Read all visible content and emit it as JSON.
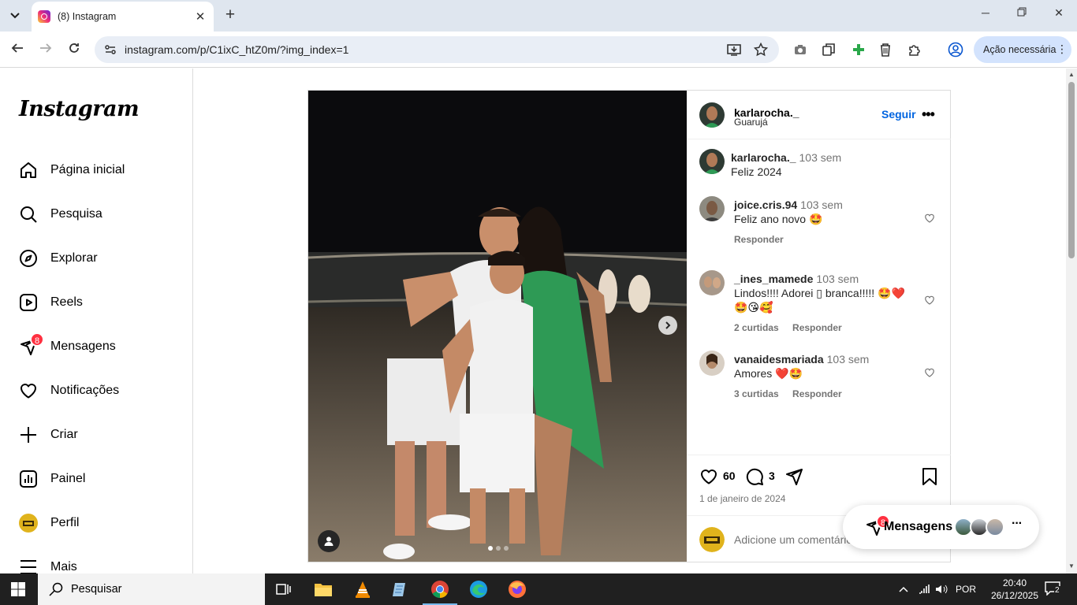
{
  "browser": {
    "tab_title": "(8) Instagram",
    "url": "instagram.com/p/C1ixC_htZ0m/?img_index=1",
    "action_chip": "Ação necessária"
  },
  "sidebar": {
    "logo": "Instagram",
    "items": [
      {
        "label": "Página inicial",
        "icon": "home-icon"
      },
      {
        "label": "Pesquisa",
        "icon": "search-icon"
      },
      {
        "label": "Explorar",
        "icon": "compass-icon"
      },
      {
        "label": "Reels",
        "icon": "reels-icon"
      },
      {
        "label": "Mensagens",
        "icon": "messenger-icon",
        "badge": "8"
      },
      {
        "label": "Notificações",
        "icon": "heart-icon"
      },
      {
        "label": "Criar",
        "icon": "plus-icon"
      },
      {
        "label": "Painel",
        "icon": "dashboard-icon"
      },
      {
        "label": "Perfil",
        "icon": "profile-avatar"
      },
      {
        "label": "Mais",
        "icon": "menu-icon"
      }
    ]
  },
  "post": {
    "author": "karlarocha._",
    "location": "Guarujá",
    "follow_label": "Seguir",
    "caption": {
      "user": "karlarocha._",
      "time": "103 sem",
      "text": "Feliz 2024"
    },
    "comments": [
      {
        "user": "joice.cris.94",
        "time": "103 sem",
        "text": "Feliz ano novo",
        "emojis": "🤩",
        "likes": "",
        "reply": "Responder"
      },
      {
        "user": "_ines_mamede",
        "time": "103 sem",
        "text": "Lindos!!!! Adorei ▯ branca!!!!!",
        "emojis": "🤩❤️ 🤩😘🥰",
        "likes": "2 curtidas",
        "reply": "Responder"
      },
      {
        "user": "vanaidesmariada",
        "time": "103 sem",
        "text": "Amores",
        "emojis": "❤️🤩",
        "likes": "3 curtidas",
        "reply": "Responder"
      }
    ],
    "like_count": "60",
    "comment_count": "3",
    "date": "1 de janeiro de 2024",
    "add_comment_placeholder": "Adicione um comentário...",
    "carousel_total": 3,
    "carousel_index": 1
  },
  "messages_pill": {
    "label": "Mensagens",
    "badge": "8"
  },
  "taskbar": {
    "search_label": "Pesquisar",
    "language": "POR",
    "time": "20:40",
    "date": "26/12/2025",
    "notifications": "2"
  },
  "colors": {
    "link": "#0064e0",
    "badge": "#ff3040",
    "chip": "#d3e3fd"
  }
}
